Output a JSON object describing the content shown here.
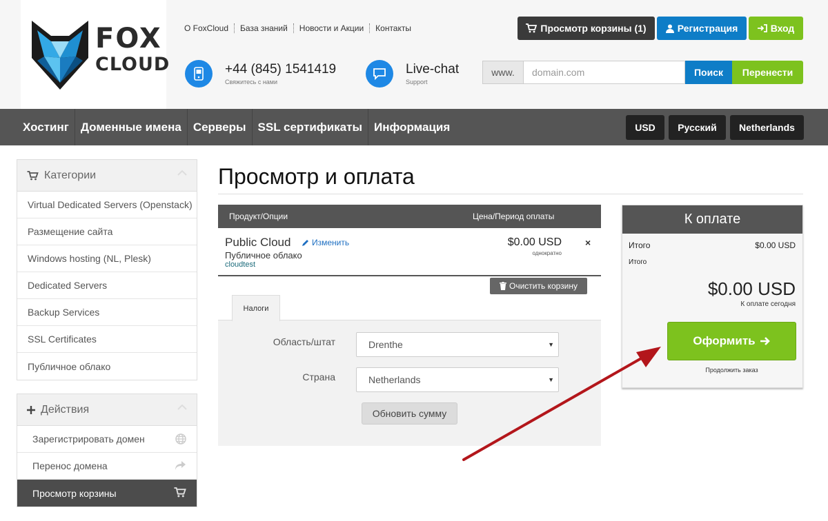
{
  "header": {
    "logo_line1": "FOX",
    "logo_line2": "CLOUD",
    "links": [
      "О FoxCloud",
      "База знаний",
      "Новости и Акции",
      "Контакты"
    ],
    "cart_button": "Просмотр корзины (1)",
    "register_button": "Регистрация",
    "login_button": "Вход",
    "phone": "+44 (845) 1541419",
    "phone_sub": "Свяжитесь с нами",
    "chat": "Live-chat",
    "chat_sub": "Support",
    "domain_prefix": "www.",
    "domain_placeholder": "domain.com",
    "search_button": "Поиск",
    "transfer_button": "Перенести"
  },
  "nav": {
    "items": [
      "Хостинг",
      "Доменные имена",
      "Серверы",
      "SSL сертификаты",
      "Информация"
    ],
    "currency": "USD",
    "language": "Русский",
    "country": "Netherlands"
  },
  "sidebar": {
    "categories_title": "Категории",
    "categories": [
      "Virtual Dedicated Servers (Openstack)",
      "Размещение сайта",
      "Windows hosting (NL, Plesk)",
      "Dedicated Servers",
      "Backup Services",
      "SSL Certificates",
      "Публичное облако"
    ],
    "actions_title": "Действия",
    "actions": [
      "Зарегистрировать домен",
      "Перенос домена",
      "Просмотр корзины"
    ]
  },
  "main": {
    "title": "Просмотр и оплата",
    "col_product": "Продукт/Опции",
    "col_price": "Цена/Период оплаты",
    "product_name": "Public Cloud",
    "edit_link": "Изменить",
    "product_sub": "Публичное облако",
    "product_domain": "cloudtest",
    "price": "$0.00 USD",
    "cycle": "однократно",
    "remove": "×",
    "clear_cart": "Очистить корзину",
    "tab_taxes": "Налоги",
    "label_region": "Область/штат",
    "region_value": "Drenthe",
    "label_country": "Страна",
    "country_value": "Netherlands",
    "update_button": "Обновить сумму"
  },
  "summary": {
    "title": "К оплате",
    "subtotal_label": "Итого",
    "subtotal_value": "$0.00 USD",
    "total_label": "Итого",
    "total_value": "$0.00 USD",
    "due_today": "К оплате сегодня",
    "checkout_button": "Оформить",
    "continue_link": "Продолжить заказ"
  },
  "colors": {
    "brand_blue": "#0e7dc7",
    "brand_green": "#7dc21e",
    "nav_bg": "#555555",
    "annotation_arrow": "#b3161b"
  }
}
